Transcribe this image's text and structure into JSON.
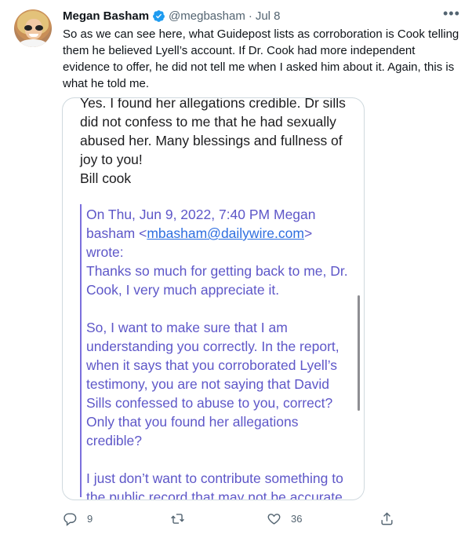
{
  "tweet": {
    "author_name": "Megan Basham",
    "verified": true,
    "handle": "@megbasham",
    "separator": "·",
    "time": "Jul 8",
    "more_glyph": "•••",
    "text": "So as we can see here, what Guidepost lists as corroboration is Cook telling them he believed Lyell’s account. If Dr. Cook had more independent evidence to offer, he did not tell me when I asked him about it. Again, this is what he told me."
  },
  "media": {
    "reply_lines": [
      "Yes. I found her allegations credible. Dr sills",
      "did not confess to me that he had sexually",
      "abused her. Many blessings and fullness of",
      "joy to you!",
      "Bill cook"
    ],
    "quote_header_1": "On Thu, Jun 9, 2022, 7:40 PM Megan",
    "quote_header_2_pre": "basham <",
    "quote_header_2_link": "mbasham@dailywire.com",
    "quote_header_2_post": "> wrote:",
    "quote_para1": [
      "Thanks so much for getting back to me, Dr.",
      "Cook, I very much appreciate it."
    ],
    "quote_para2": [
      "So, I want to make sure that I am",
      "understanding you correctly. In the report,",
      "when it says that you corroborated Lyell’s",
      "testimony, you are not saying that David",
      "Sills confessed to abuse to you, correct?",
      "Only that you found her allegations",
      "credible?"
    ],
    "quote_para3": [
      "I just don’t want to contribute something to",
      "the public record that may not be accurate."
    ]
  },
  "actions": {
    "reply_count": "9",
    "retweet_count": "",
    "like_count": "36",
    "icons": [
      "reply-icon",
      "retweet-icon",
      "like-icon",
      "share-icon"
    ]
  },
  "colors": {
    "verified": "#1d9bf0",
    "secondary_text": "#536471",
    "quote_text": "#5e57c8",
    "link": "#2f6fe0"
  }
}
